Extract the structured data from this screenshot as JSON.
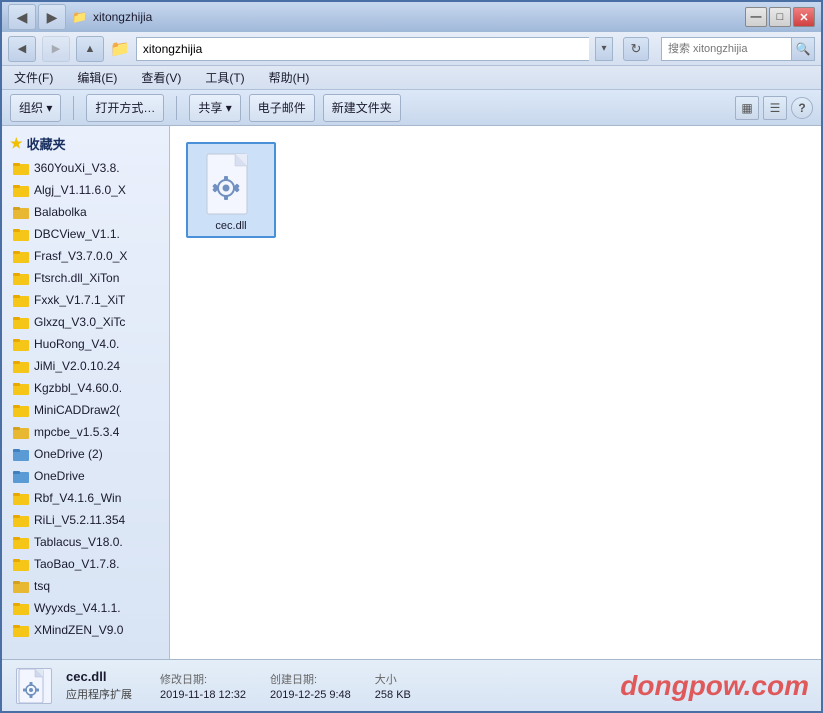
{
  "window": {
    "title": "xitongzhijia",
    "controls": {
      "minimize": "—",
      "maximize": "□",
      "close": "✕"
    }
  },
  "navbar": {
    "back_tooltip": "Back",
    "forward_tooltip": "Forward",
    "folder_icon": "📁",
    "address": "xitongzhijia",
    "refresh": "↻",
    "search_placeholder": "搜索 xitongzhijia",
    "search_icon": "🔍"
  },
  "menubar": {
    "items": [
      {
        "id": "file",
        "label": "文件(F)"
      },
      {
        "id": "edit",
        "label": "编辑(E)"
      },
      {
        "id": "view",
        "label": "查看(V)"
      },
      {
        "id": "tools",
        "label": "工具(T)"
      },
      {
        "id": "help",
        "label": "帮助(H)"
      }
    ]
  },
  "toolbar": {
    "organize_label": "组织 ▾",
    "open_label": "打开方式…",
    "share_label": "共享 ▾",
    "email_label": "电子邮件",
    "new_folder_label": "新建文件夹",
    "view_icon": "▦",
    "layout_icon": "☰",
    "help_icon": "?"
  },
  "sidebar": {
    "header": "收藏夹",
    "items": [
      {
        "id": "item-360",
        "label": "360YouXi_V3.8.",
        "type": "folder-yellow"
      },
      {
        "id": "item-algj",
        "label": "Algj_V1.11.6.0_X",
        "type": "folder-yellow"
      },
      {
        "id": "item-balabolka",
        "label": "Balabolka",
        "type": "folder-plain"
      },
      {
        "id": "item-dbcview",
        "label": "DBCView_V1.1.",
        "type": "folder-yellow"
      },
      {
        "id": "item-frasf",
        "label": "Frasf_V3.7.0.0_X",
        "type": "folder-yellow"
      },
      {
        "id": "item-ftsrch",
        "label": "Ftsrch.dll_XiTon",
        "type": "folder-yellow"
      },
      {
        "id": "item-fxxk",
        "label": "Fxxk_V1.7.1_XiT",
        "type": "folder-yellow"
      },
      {
        "id": "item-glxzq",
        "label": "Glxzq_V3.0_XiTc",
        "type": "folder-yellow"
      },
      {
        "id": "item-huorong",
        "label": "HuoRong_V4.0.",
        "type": "folder-yellow"
      },
      {
        "id": "item-jimi",
        "label": "JiMi_V2.0.10.24",
        "type": "folder-yellow"
      },
      {
        "id": "item-kgzbbl",
        "label": "Kgzbbl_V4.60.0.",
        "type": "folder-yellow"
      },
      {
        "id": "item-minicad",
        "label": "MiniCADDraw2(",
        "type": "folder-yellow"
      },
      {
        "id": "item-mpcbe",
        "label": "mpcbe_v1.5.3.4",
        "type": "folder-plain"
      },
      {
        "id": "item-onedrive2",
        "label": "OneDrive (2)",
        "type": "folder-blue"
      },
      {
        "id": "item-onedrive",
        "label": "OneDrive",
        "type": "folder-blue"
      },
      {
        "id": "item-rbf",
        "label": "Rbf_V4.1.6_Win",
        "type": "folder-yellow"
      },
      {
        "id": "item-rili",
        "label": "RiLi_V5.2.11.354",
        "type": "folder-yellow"
      },
      {
        "id": "item-tablacus",
        "label": "Tablacus_V18.0.",
        "type": "folder-yellow"
      },
      {
        "id": "item-taobao",
        "label": "TaoBao_V1.7.8.",
        "type": "folder-yellow"
      },
      {
        "id": "item-tsq",
        "label": "tsq",
        "type": "folder-plain"
      },
      {
        "id": "item-wyyxds",
        "label": "Wyyxds_V4.1.1.",
        "type": "folder-yellow"
      },
      {
        "id": "item-xmind",
        "label": "XMindZEN_V9.0",
        "type": "folder-yellow"
      }
    ]
  },
  "files": [
    {
      "id": "cec-dll",
      "name": "cec.dll",
      "type": "dll",
      "selected": true
    }
  ],
  "statusbar": {
    "filename": "cec.dll",
    "filetype": "应用程序扩展",
    "modify_label": "修改日期:",
    "modify_date": "2019-11-18 12:32",
    "create_label": "创建日期:",
    "create_date": "2019-12-25 9:48",
    "size_label": "大小",
    "size_value": "258 KB",
    "watermark": "dongpow.com"
  }
}
